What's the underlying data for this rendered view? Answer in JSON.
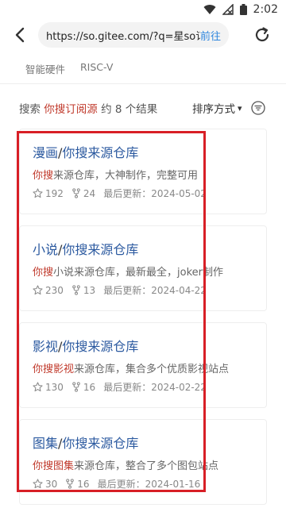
{
  "status_bar": {
    "time": "2:02"
  },
  "url_bar": {
    "url": "https://so.gitee.com/?q=星so订",
    "go_label": "前往"
  },
  "tabs": [
    {
      "label": "智能硬件"
    },
    {
      "label": "RISC-V"
    }
  ],
  "summary": {
    "prefix": "搜索 ",
    "keyword": "你搜订阅源",
    "suffix": " 约 8 个结果",
    "sort_label": "排序方式",
    "sort_arrow": "▾"
  },
  "results": [
    {
      "title_a": "漫画",
      "title_sep": "/",
      "title_b": "你搜来源仓库",
      "desc_hl": "你搜",
      "desc_rest": "来源仓库，大神制作，完整可用",
      "stars": "192",
      "forks": "24",
      "updated_label": "最后更新：",
      "updated": "2024-05-02"
    },
    {
      "title_a": "小说",
      "title_sep": "/",
      "title_b": "你搜来源仓库",
      "desc_hl": "你搜",
      "desc_rest": "小说来源仓库，最新最全，joker制作",
      "stars": "230",
      "forks": "13",
      "updated_label": "最后更新：",
      "updated": "2024-04-22"
    },
    {
      "title_a": "影视",
      "title_sep": "/",
      "title_b": "你搜来源仓库",
      "desc_hl": "你搜影视",
      "desc_rest": "来源仓库，集合多个优质影视站点",
      "stars": "130",
      "forks": "16",
      "updated_label": "最后更新：",
      "updated": "2024-02-22"
    },
    {
      "title_a": "图集",
      "title_sep": "/",
      "title_b": "你搜来源仓库",
      "desc_hl": "你搜图集",
      "desc_rest": "来源仓库，整合了多个图包站点",
      "stars": "30",
      "forks": "16",
      "updated_label": "最后更新：",
      "updated": "2024-01-16"
    }
  ],
  "colors": {
    "accent": "#2e86de",
    "keyword": "#c0392b",
    "title": "#2c5aa0",
    "highlight_frame": "#d81f26"
  }
}
